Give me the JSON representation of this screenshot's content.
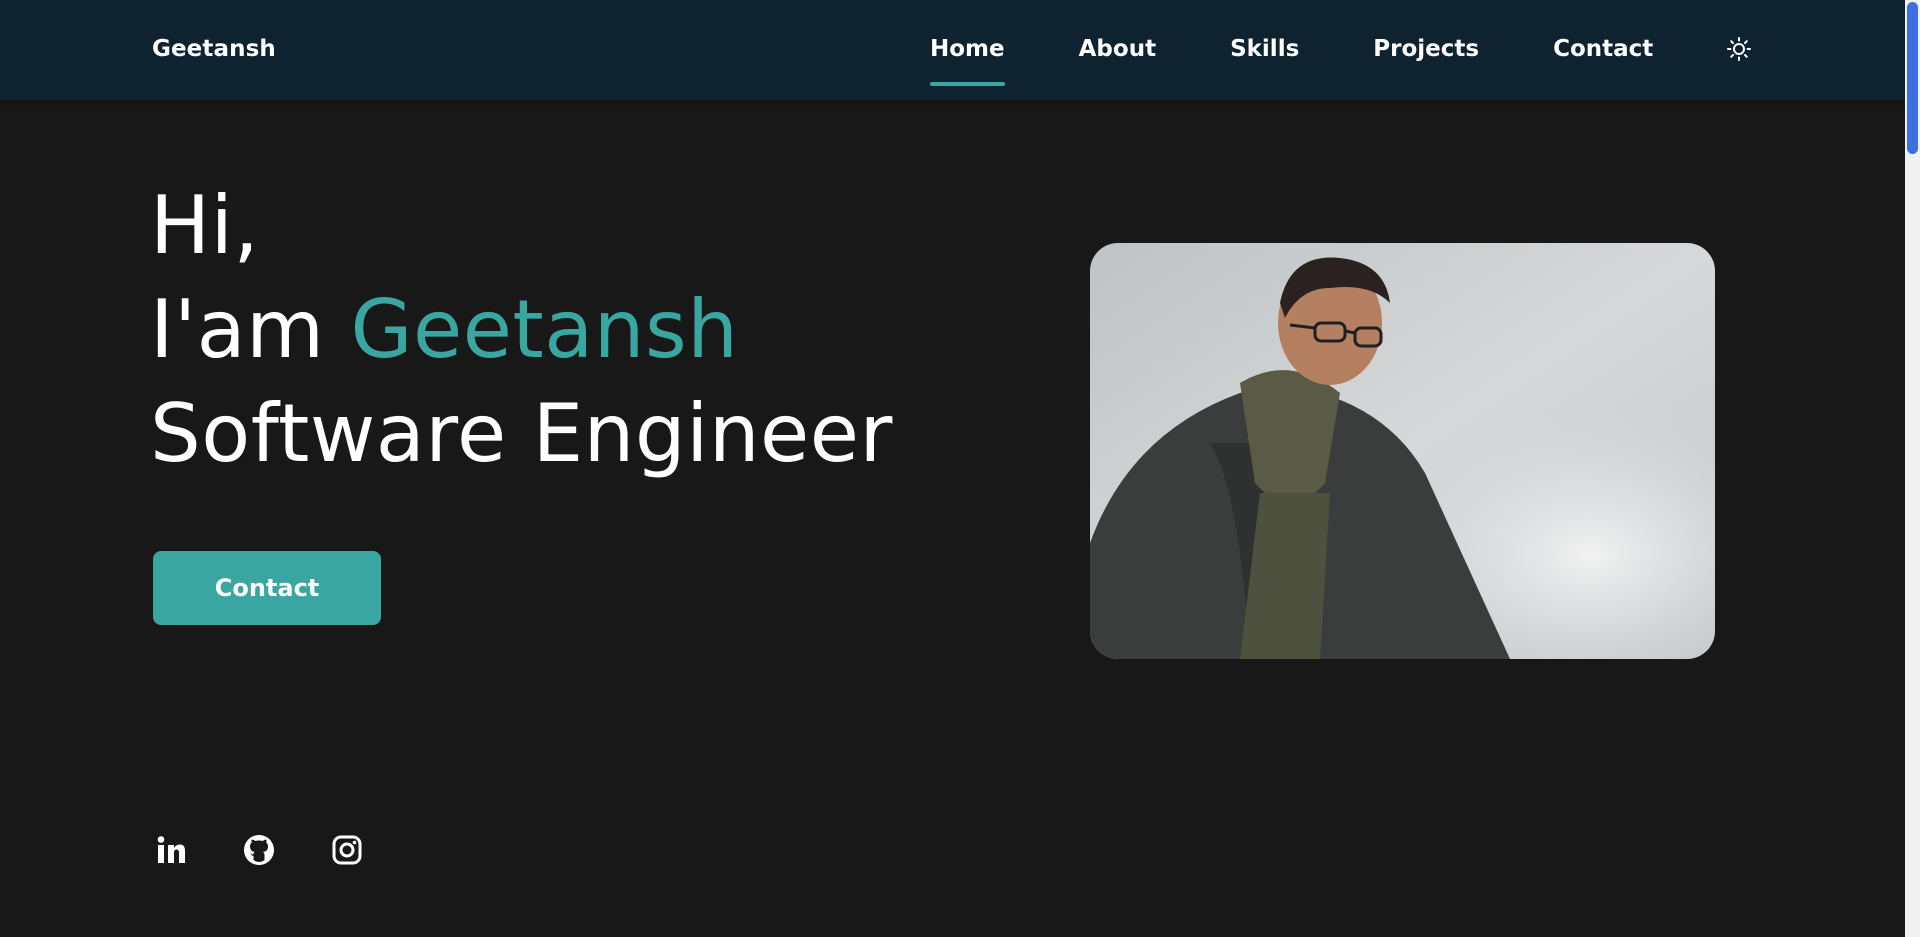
{
  "header": {
    "logo": "Geetansh",
    "nav": [
      {
        "label": "Home",
        "active": true
      },
      {
        "label": "About",
        "active": false
      },
      {
        "label": "Skills",
        "active": false
      },
      {
        "label": "Projects",
        "active": false
      },
      {
        "label": "Contact",
        "active": false
      }
    ],
    "theme_toggle_icon": "sun-icon"
  },
  "hero": {
    "greeting": "Hi,",
    "intro_prefix": "I'am",
    "name": "Geetansh",
    "role": "Software Engineer",
    "contact_button": "Contact",
    "photo_icon": "profile-photo"
  },
  "socials": [
    {
      "name": "linkedin-icon"
    },
    {
      "name": "github-icon"
    },
    {
      "name": "instagram-icon"
    }
  ],
  "colors": {
    "background": "#181818",
    "header": "#0f2230",
    "accent": "#3aa6a2",
    "text": "#ffffff",
    "scroll_thumb": "#3d6fe0"
  }
}
